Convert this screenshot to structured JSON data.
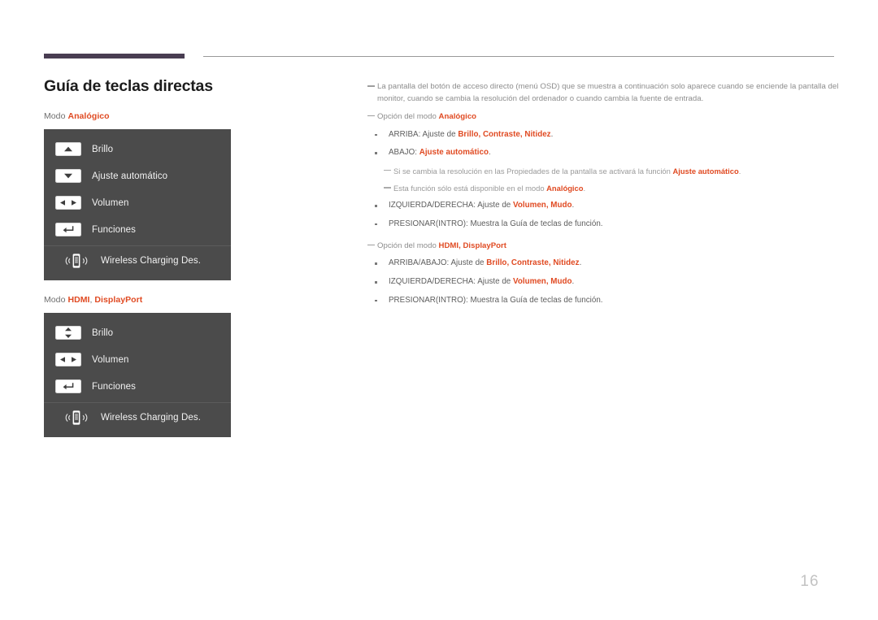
{
  "page": {
    "number": "16",
    "title": "Guía de teclas directas"
  },
  "left": {
    "mode1": {
      "prefix": "Modo",
      "values": [
        "Analógico"
      ]
    },
    "mode2": {
      "prefix": "Modo",
      "values": [
        "HDMI",
        "DisplayPort"
      ]
    },
    "osd_analog": {
      "rows": [
        {
          "icon": "arrow-up-icon",
          "label": "Brillo"
        },
        {
          "icon": "arrow-down-icon",
          "label": "Ajuste automático"
        },
        {
          "icon": "arrow-left-right-icon",
          "label": "Volumen"
        },
        {
          "icon": "enter-return-icon",
          "label": "Funciones"
        }
      ],
      "wireless": {
        "icon": "wireless-charging-icon",
        "label": "Wireless Charging Des."
      }
    },
    "osd_digital": {
      "rows": [
        {
          "icon": "arrow-up-down-icon",
          "label": "Brillo"
        },
        {
          "icon": "arrow-left-right-icon",
          "label": "Volumen"
        },
        {
          "icon": "enter-return-icon",
          "label": "Funciones"
        }
      ],
      "wireless": {
        "icon": "wireless-charging-icon",
        "label": "Wireless Charging Des."
      }
    }
  },
  "right": {
    "note_intro": "La pantalla del botón de acceso directo (menú OSD) que se muestra a continuación solo aparece cuando se enciende la pantalla del monitor, cuando se cambia la resolución del ordenador o cuando cambia la fuente de entrada.",
    "analog_section": {
      "note_prefix": "Opción del modo ",
      "note_hl": "Analógico",
      "bullets": [
        {
          "pre": "ARRIBA: Ajuste de ",
          "hl": "Brillo, Contraste, Nitidez",
          "post": "."
        },
        {
          "pre": "ABAJO: ",
          "hl": "Ajuste automático",
          "post": "."
        }
      ],
      "subnotes": [
        {
          "pre": "Si se cambia la resolución en las Propiedades de la pantalla se activará la función ",
          "hl": "Ajuste automático",
          "post": "."
        },
        {
          "pre": "Esta función sólo está disponible en el modo ",
          "hl": "Analógico",
          "post": "."
        }
      ],
      "bullets_tail": [
        {
          "pre": "IZQUIERDA/DERECHA: Ajuste de ",
          "hl": "Volumen, Mudo",
          "post": "."
        },
        {
          "pre": "PRESIONAR(INTRO): Muestra la Guía de teclas de función.",
          "hl": "",
          "post": ""
        }
      ]
    },
    "digital_section": {
      "note_prefix": "Opción del modo ",
      "note_hl": "HDMI, DisplayPort",
      "bullets": [
        {
          "pre": "ARRIBA/ABAJO: Ajuste de ",
          "hl": "Brillo, Contraste, Nitidez",
          "post": "."
        },
        {
          "pre": "IZQUIERDA/DERECHA: Ajuste de ",
          "hl": "Volumen, Mudo",
          "post": "."
        },
        {
          "pre": "PRESIONAR(INTRO): Muestra la Guía de teclas de función.",
          "hl": "",
          "post": ""
        }
      ]
    }
  },
  "colors": {
    "accent": "#e04a22",
    "header_bar": "#493d52",
    "osd_bg": "#4b4b4b"
  }
}
